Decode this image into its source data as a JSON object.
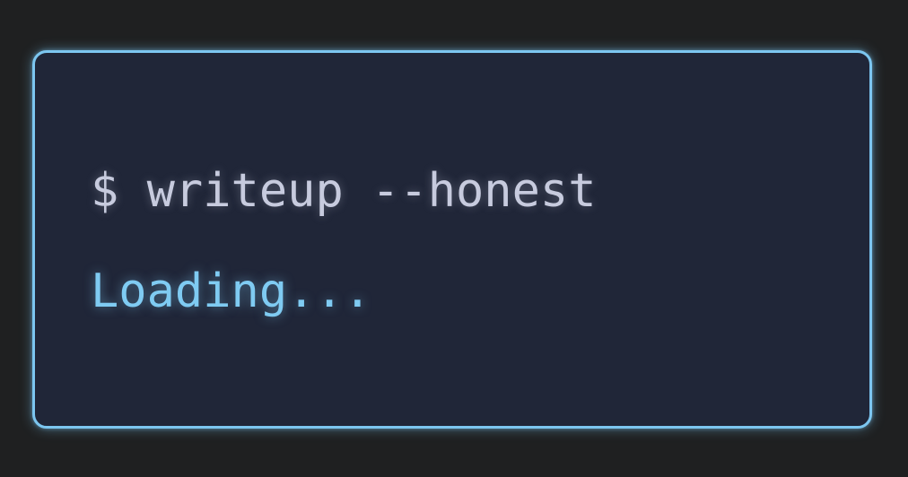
{
  "terminal": {
    "prompt": "$",
    "command": "writeup --honest",
    "status": "Loading..."
  },
  "colors": {
    "background": "#1f2021",
    "panel": "#202638",
    "border": "#7cc6f0",
    "command_text": "#c7cbde",
    "status_text": "#7fcbf2"
  }
}
